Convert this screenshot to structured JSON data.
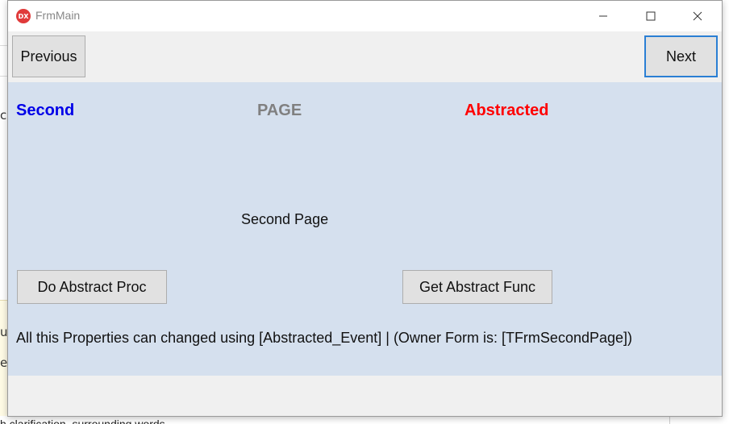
{
  "window": {
    "title": "FrmMain",
    "app_icon": "DX"
  },
  "toolbar": {
    "previous_label": "Previous",
    "next_label": "Next"
  },
  "page": {
    "label_second": "Second",
    "label_page": "PAGE",
    "label_abstracted": "Abstracted",
    "center_text": "Second Page",
    "do_abstract_proc_label": "Do Abstract Proc",
    "get_abstract_func_label": "Get Abstract Func",
    "info_text": "All this Properties can changed using [Abstracted_Event] | (Owner Form is: [TFrmSecondPage])"
  },
  "background": {
    "left_chars": [
      "c",
      "u",
      "e"
    ],
    "bottom_text": "h clarification, surrounding words"
  },
  "colors": {
    "content_bg": "#d5e0ee",
    "second_color": "#0000e8",
    "page_color": "#808080",
    "abstracted_color": "#ff0000",
    "focus_border": "#2a7fd4"
  }
}
